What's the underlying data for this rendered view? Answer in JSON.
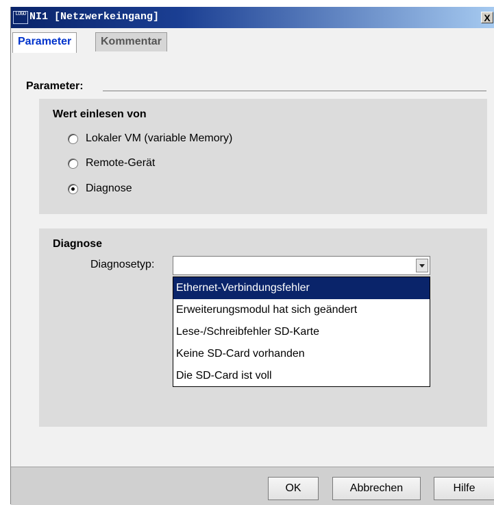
{
  "window": {
    "title": "NI1 [Netzwerkeingang]",
    "logo_text": "LOGO",
    "close_symbol": "X"
  },
  "tabs": [
    {
      "label": "Parameter",
      "active": true
    },
    {
      "label": "Kommentar",
      "active": false
    }
  ],
  "parameters": {
    "section_label": "Parameter:",
    "read_value": {
      "title": "Wert einlesen von",
      "options": [
        {
          "label": "Lokaler VM (variable Memory)",
          "selected": false
        },
        {
          "label": "Remote-Gerät",
          "selected": false
        },
        {
          "label": "Diagnose",
          "selected": true
        }
      ]
    },
    "diagnose": {
      "title": "Diagnose",
      "type_label": "Diagnosetyp:",
      "type_value": "",
      "dropdown_items": [
        {
          "label": "Ethernet-Verbindungsfehler",
          "highlighted": true
        },
        {
          "label": "Erweiterungsmodul hat sich geändert",
          "highlighted": false
        },
        {
          "label": "Lese-/Schreibfehler SD-Karte",
          "highlighted": false
        },
        {
          "label": "Keine SD-Card vorhanden",
          "highlighted": false
        },
        {
          "label": "Die SD-Card ist voll",
          "highlighted": false
        }
      ]
    }
  },
  "buttons": {
    "ok": "OK",
    "cancel": "Abbrechen",
    "help": "Hilfe"
  },
  "colors": {
    "title_bar": "#0a246a",
    "active_tab_text": "#0033cc",
    "highlight": "#0a246a",
    "panel_bg": "#dcdcdc"
  }
}
